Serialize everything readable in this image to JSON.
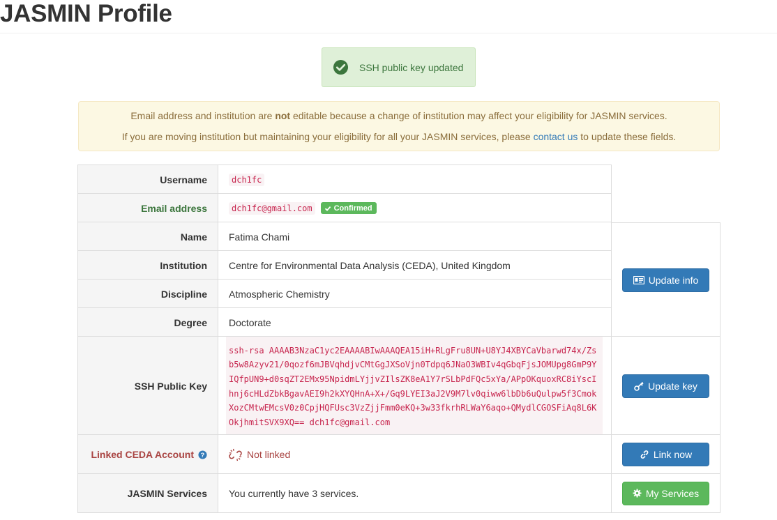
{
  "page": {
    "title": "JASMIN Profile"
  },
  "alerts": {
    "success": "SSH public key updated",
    "warning_line1_pre": "Email address and institution are ",
    "warning_line1_bold": "not",
    "warning_line1_post": " editable because a change of institution may affect your eligibility for JASMIN services.",
    "warning_line2_pre": "If you are moving institution but maintaining your eligibility for all your JASMIN services, please ",
    "warning_link": "contact us",
    "warning_line2_post": " to update these fields."
  },
  "profile": {
    "username_label": "Username",
    "username": "dch1fc",
    "email_label": "Email address",
    "email": "dch1fc@gmail.com",
    "email_badge": "Confirmed",
    "name_label": "Name",
    "name": "Fatima Chami",
    "institution_label": "Institution",
    "institution": "Centre for Environmental Data Analysis (CEDA), United Kingdom",
    "discipline_label": "Discipline",
    "discipline": "Atmospheric Chemistry",
    "degree_label": "Degree",
    "degree": "Doctorate",
    "ssh_label": "SSH Public Key",
    "ssh_key": "ssh-rsa AAAAB3NzaC1yc2EAAAABIwAAAQEA15iH+RLgFru8UN+U8YJ4XBYCaVbarwd74x/Zsb5w8Azyv21/0qozf6mJBVqhdjvCMtGgJXSoVjn0Tdpq6JNaO3WBIv4qGbqFjsJOMUpg8GmP9YIQfpUN9+d0sqZT2EMx95NpidmLYjjvZIlsZK8eA1Y7rSLbPdFQc5xYa/APpOKquoxRC8iYscIhnj6cHLdZbkBgavAEI9h2kXYQHnA+X+/Gq9LYEI3aJ2V9M7lv0qiww6lbDb6uQulpw5f3CmokXozCMtwEMcsV0z0CpjHQFUsc3VzZjjFmm0eKQ+3w33fkrhRLWaY6aqo+QMydlCGOSFiAq8L6KOkjhmitSVX9XQ== dch1fc@gmail.com",
    "linked_label": "Linked CEDA Account",
    "linked_value": "Not linked",
    "services_label": "JASMIN Services",
    "services_value": "You currently have 3 services."
  },
  "buttons": {
    "update_info": "Update info",
    "update_key": "Update key",
    "link_now": "Link now",
    "my_services": "My Services"
  },
  "icons": {
    "success": "check-circle-icon",
    "badge": "check-icon",
    "update_info": "id-card-icon",
    "update_key": "key-icon",
    "help": "question-circle-icon",
    "unlink": "unlink-icon",
    "link": "link-icon",
    "services": "gear-icon"
  },
  "colors": {
    "primary": "#337ab7",
    "success": "#5cb85c",
    "danger_text": "#a94442",
    "success_text": "#3c763d",
    "warning_text": "#8a6d3b",
    "code": "#c7254e"
  }
}
